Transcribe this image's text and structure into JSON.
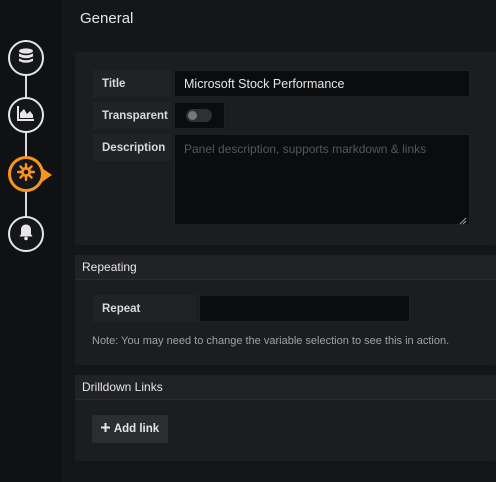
{
  "heading": "General",
  "general": {
    "title_label": "Title",
    "title_value": "Microsoft Stock Performance",
    "transparent_label": "Transparent",
    "transparent_on": false,
    "description_label": "Description",
    "description_placeholder": "Panel description, supports markdown & links"
  },
  "repeating": {
    "header": "Repeating",
    "repeat_label": "Repeat",
    "repeat_value": "",
    "note": "Note: You may need to change the variable selection to see this in action."
  },
  "drilldown": {
    "header": "Drilldown Links",
    "add_link_label": "Add link"
  },
  "sidebar": {
    "steps": [
      "database-icon",
      "chart-icon",
      "settings-icon",
      "bell-icon"
    ],
    "active_step": "settings-icon"
  },
  "colors": {
    "accent": "#f7941e",
    "background": "#141619"
  }
}
